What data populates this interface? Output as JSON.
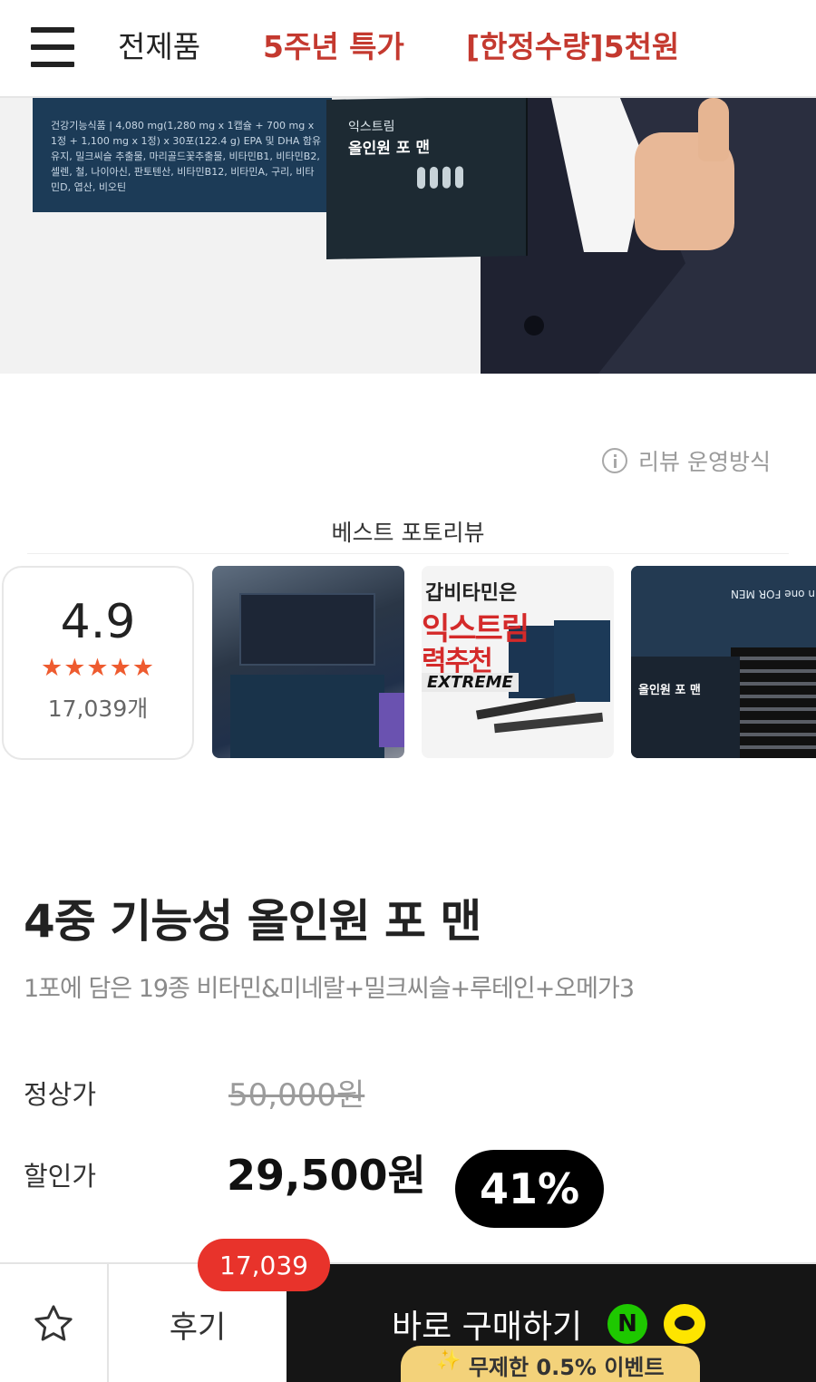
{
  "header": {
    "nav": [
      "전제품",
      "5주년 특가",
      "[한정수량]5천원"
    ],
    "accent_color": "#c4392f"
  },
  "hero": {
    "box_text": "건강기능식품 | 4,080 mg(1,280 mg x 1캡슐 + 700 mg x 1정 + 1,100 mg x 1정) x 30포(122.4 g)  EPA 및 DHA 함유 유지, 밀크씨슬 추출물, 마리골드꽃추출물, 비타민B1, 비타민B2, 셀렌, 철, 나이아신, 판토텐산, 비타민B12, 비타민A, 구리, 비타민D, 엽산, 비오틴",
    "pack_title": "익스트림",
    "pack_name": "올인원 포 맨"
  },
  "review_policy": {
    "label": "리뷰 운영방식",
    "icon": "info-icon"
  },
  "best_review": {
    "title": "베스트 포토리뷰",
    "rating": "4.9",
    "stars": "★★★★★",
    "count": "17,039개",
    "thumb2": {
      "line1": "갑비타민은",
      "line2": "익스트림",
      "line3": "력추천",
      "brand": "EXTREME"
    },
    "thumb3": {
      "brand_top": "EXTREME All in one FOR MEN",
      "pack_name": "올인원 포 맨"
    }
  },
  "product": {
    "title": "4중 기능성 올인원 포 맨",
    "subtitle": "1포에 담은 19종 비타민&미네랄+밀크씨슬+루테인+오메가3",
    "regular_label": "정상가",
    "regular_price": "50,000원",
    "sale_label": "할인가",
    "sale_price": "29,500원",
    "discount": "41%"
  },
  "bottom_bar": {
    "review_label": "후기",
    "review_count": "17,039",
    "buy_label": "바로 구매하기",
    "npay_letter": "N",
    "event_label": "무제한 0.5% 이벤트",
    "badge_color": "#e8332b"
  }
}
